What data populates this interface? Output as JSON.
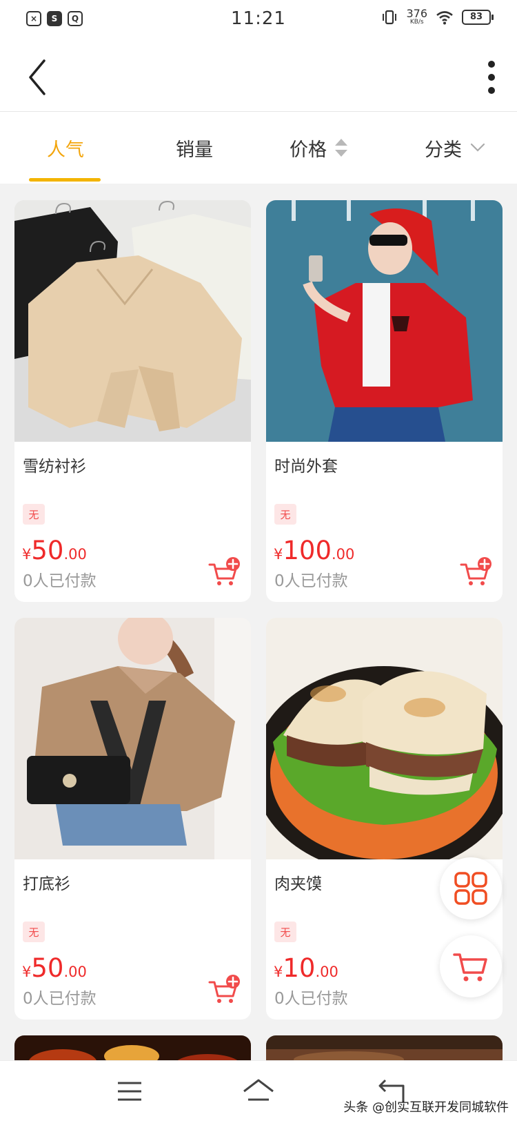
{
  "status_bar": {
    "time": "11:21",
    "net_speed": "376",
    "net_unit": "KB/s",
    "battery": "83",
    "left_icons": [
      "notification-x-icon",
      "sync-app-icon",
      "search-app-icon"
    ]
  },
  "tabs": [
    {
      "label": "人气",
      "active": true
    },
    {
      "label": "销量",
      "active": false
    },
    {
      "label": "价格",
      "active": false
    },
    {
      "label": "分类",
      "active": false
    }
  ],
  "products": [
    {
      "title": "雪纺衬衫",
      "tag": "无",
      "currency": "¥",
      "price_int": "50",
      "price_dec": ".00",
      "sold": "0人已付款"
    },
    {
      "title": "时尚外套",
      "tag": "无",
      "currency": "¥",
      "price_int": "100",
      "price_dec": ".00",
      "sold": "0人已付款"
    },
    {
      "title": "打底衫",
      "tag": "无",
      "currency": "¥",
      "price_int": "50",
      "price_dec": ".00",
      "sold": "0人已付款"
    },
    {
      "title": "肉夹馍",
      "tag": "无",
      "currency": "¥",
      "price_int": "10",
      "price_dec": ".00",
      "sold": "0人已付款"
    }
  ],
  "colors": {
    "accent": "#f3a50c",
    "price": "#ef2a2a",
    "cart": "#f14b4b"
  },
  "watermark": "头条 @创实互联开发同城软件"
}
